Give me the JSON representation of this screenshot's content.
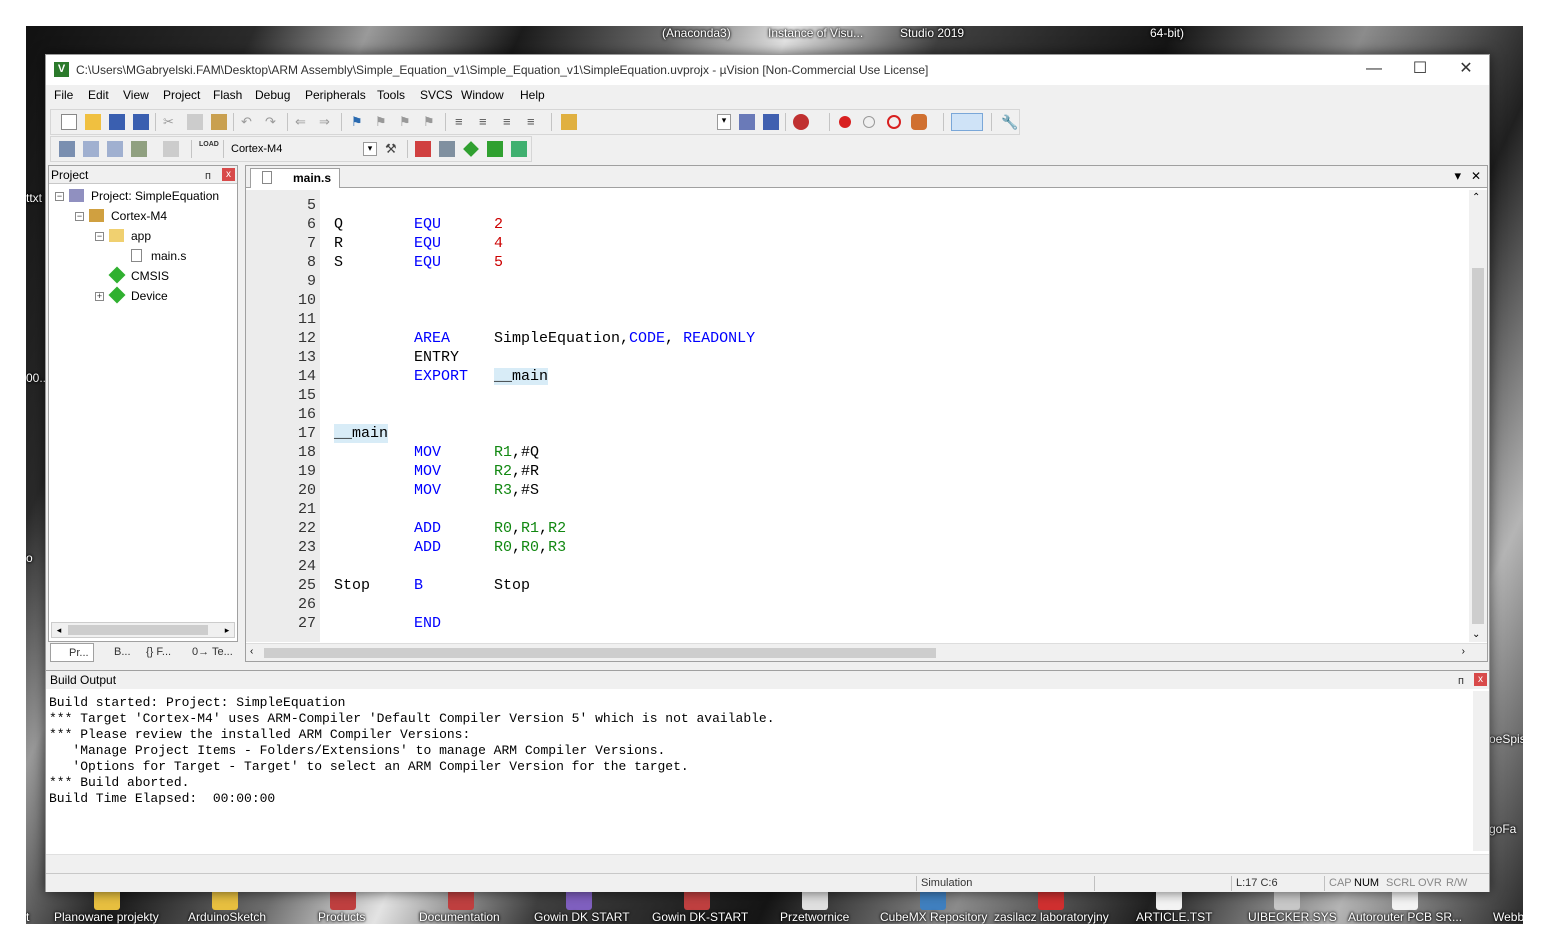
{
  "desktop": {
    "top_texts": [
      "(Anaconda3)",
      "Instance of Visu...",
      "Studio 2019",
      "64-bit)"
    ],
    "left_texts": [
      "ttxt",
      "00...",
      "o"
    ],
    "right_texts": [
      "oeSpis",
      "goFa"
    ],
    "taskbar_icons": [
      "t",
      "Planowane projekty",
      "ArduinoSketch",
      "Products",
      "Documentation",
      "Gowin DK START",
      "Gowin DK-START",
      "Przetwornice",
      "CubeMX Repository",
      "zasilacz laboratoryjny",
      "ARTICLE.TST",
      "UIBECKER.SYS",
      "Autorouter PCB SR...",
      "Webb"
    ]
  },
  "window": {
    "title": "C:\\Users\\MGabryelski.FAM\\Desktop\\ARM Assembly\\Simple_Equation_v1\\Simple_Equation_v1\\SimpleEquation.uvprojx - µVision  [Non-Commercial Use License]",
    "app_logo": "V",
    "controls": [
      "—",
      "☐",
      "✕"
    ]
  },
  "menu": [
    "File",
    "Edit",
    "View",
    "Project",
    "Flash",
    "Debug",
    "Peripherals",
    "Tools",
    "SVCS",
    "Window",
    "Help"
  ],
  "toolbar2": {
    "target": "Cortex-M4",
    "load_label": "LOAD"
  },
  "project_panel": {
    "title": "Project",
    "pin": "ᴨ",
    "close": "x",
    "tree": {
      "root": "Project: SimpleEquation",
      "target": "Cortex-M4",
      "group": "app",
      "file": "main.s",
      "cmsis": "CMSIS",
      "device": "Device"
    },
    "tabs": [
      "Pr...",
      "B...",
      "{} F...",
      "0→ Te..."
    ]
  },
  "editor": {
    "tab": "main.s",
    "tab_controls": [
      "▾",
      "✕"
    ],
    "lines": [
      {
        "n": "5",
        "label": "",
        "op": "",
        "args": []
      },
      {
        "n": "6",
        "label": "Q",
        "op": "EQU",
        "args": [
          {
            "t": "2",
            "c": "num"
          }
        ]
      },
      {
        "n": "7",
        "label": "R",
        "op": "EQU",
        "args": [
          {
            "t": "4",
            "c": "num"
          }
        ]
      },
      {
        "n": "8",
        "label": "S",
        "op": "EQU",
        "args": [
          {
            "t": "5",
            "c": "num"
          }
        ]
      },
      {
        "n": "9",
        "label": "",
        "op": "",
        "args": []
      },
      {
        "n": "10",
        "label": "",
        "op": "",
        "args": []
      },
      {
        "n": "11",
        "label": "",
        "op": "",
        "args": []
      },
      {
        "n": "12",
        "label": "",
        "op": "AREA",
        "args": [
          {
            "t": "SimpleEquation,",
            "c": "plain"
          },
          {
            "t": "CODE",
            "c": "kw"
          },
          {
            "t": ", ",
            "c": "plain"
          },
          {
            "t": "READONLY",
            "c": "kw"
          }
        ]
      },
      {
        "n": "13",
        "label": "",
        "op": "ENTRY",
        "opc": "plain",
        "args": []
      },
      {
        "n": "14",
        "label": "",
        "op": "EXPORT",
        "args": [
          {
            "t": "__main",
            "c": "plain hl"
          }
        ]
      },
      {
        "n": "15",
        "label": "",
        "op": "",
        "args": []
      },
      {
        "n": "16",
        "label": "",
        "op": "",
        "args": []
      },
      {
        "n": "17",
        "label": "__main",
        "labelhl": true,
        "op": "",
        "args": []
      },
      {
        "n": "18",
        "label": "",
        "op": "MOV",
        "args": [
          {
            "t": "R1",
            "c": "reg"
          },
          {
            "t": ",#Q",
            "c": "plain"
          }
        ]
      },
      {
        "n": "19",
        "label": "",
        "op": "MOV",
        "args": [
          {
            "t": "R2",
            "c": "reg"
          },
          {
            "t": ",#R",
            "c": "plain"
          }
        ]
      },
      {
        "n": "20",
        "label": "",
        "op": "MOV",
        "args": [
          {
            "t": "R3",
            "c": "reg"
          },
          {
            "t": ",#S",
            "c": "plain"
          }
        ]
      },
      {
        "n": "21",
        "label": "",
        "op": "",
        "args": []
      },
      {
        "n": "22",
        "label": "",
        "op": "ADD",
        "args": [
          {
            "t": "R0",
            "c": "reg"
          },
          {
            "t": ",",
            "c": "plain"
          },
          {
            "t": "R1",
            "c": "reg"
          },
          {
            "t": ",",
            "c": "plain"
          },
          {
            "t": "R2",
            "c": "reg"
          }
        ]
      },
      {
        "n": "23",
        "label": "",
        "op": "ADD",
        "args": [
          {
            "t": "R0",
            "c": "reg"
          },
          {
            "t": ",",
            "c": "plain"
          },
          {
            "t": "R0",
            "c": "reg"
          },
          {
            "t": ",",
            "c": "plain"
          },
          {
            "t": "R3",
            "c": "reg"
          }
        ]
      },
      {
        "n": "24",
        "label": "",
        "op": "",
        "args": []
      },
      {
        "n": "25",
        "label": "Stop",
        "op": "B",
        "args": [
          {
            "t": "Stop",
            "c": "plain"
          }
        ]
      },
      {
        "n": "26",
        "label": "",
        "op": "",
        "args": []
      },
      {
        "n": "27",
        "label": "",
        "op": "END",
        "args": []
      }
    ]
  },
  "build_output": {
    "title": "Build Output",
    "lines": [
      "Build started: Project: SimpleEquation",
      "*** Target 'Cortex-M4' uses ARM-Compiler 'Default Compiler Version 5' which is not available.",
      "*** Please review the installed ARM Compiler Versions:",
      "   'Manage Project Items - Folders/Extensions' to manage ARM Compiler Versions.",
      "   'Options for Target - Target' to select an ARM Compiler Version for the target.",
      "*** Build aborted.",
      "Build Time Elapsed:  00:00:00"
    ]
  },
  "status": {
    "mode": "Simulation",
    "position": "L:17 C:6",
    "indicators": [
      "CAP",
      "NUM",
      "SCRL",
      "OVR",
      "R/W"
    ]
  },
  "colors": {
    "keyword": "#0000ff",
    "number": "#cc0000",
    "register": "#118811",
    "close_red": "#d84a4a"
  }
}
